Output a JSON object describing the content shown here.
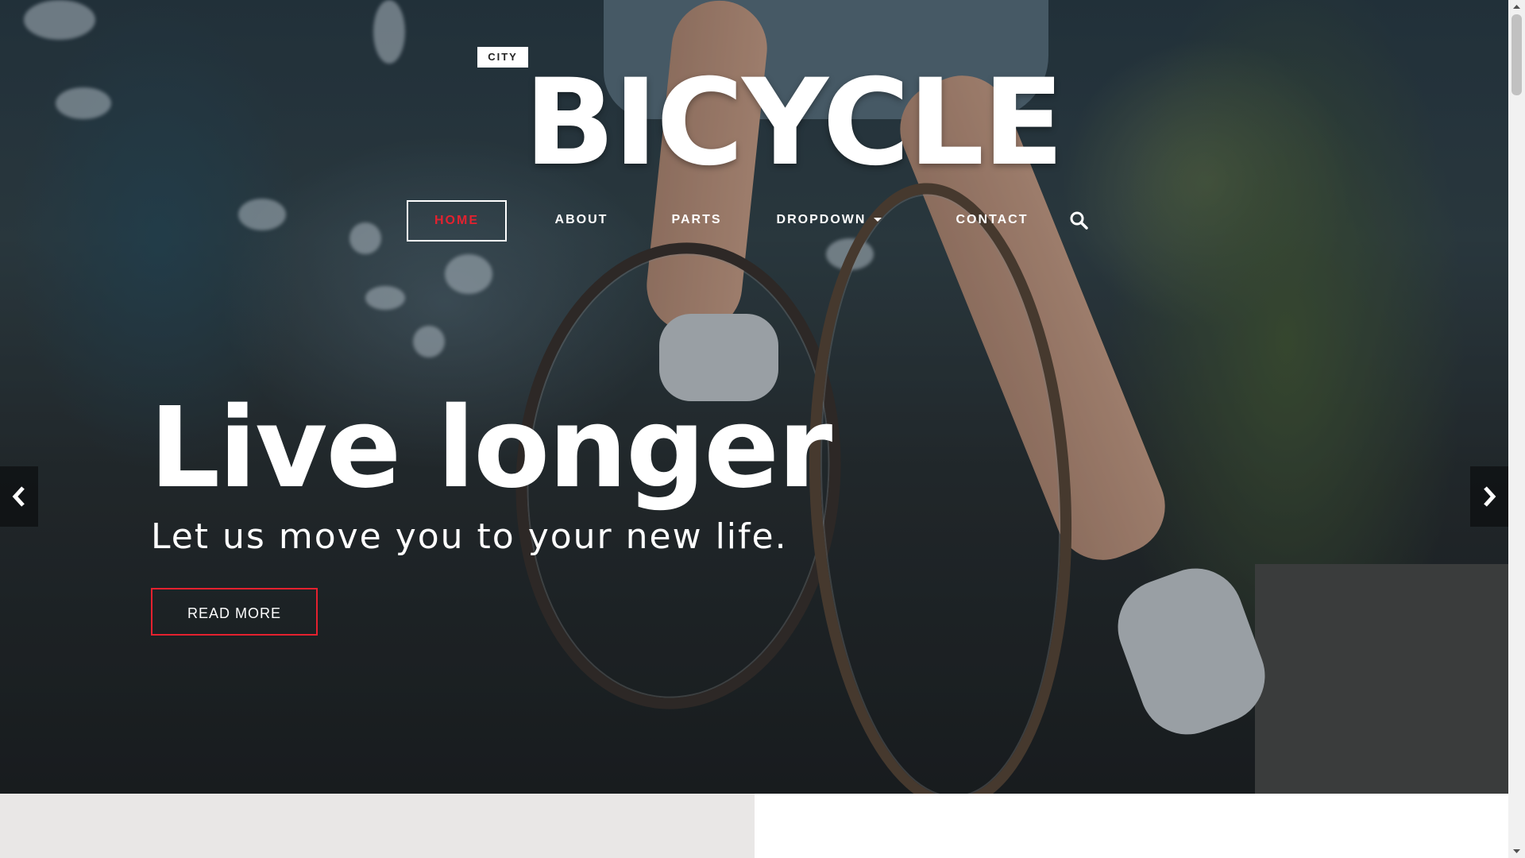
{
  "brand": {
    "tag": "CITY",
    "title": "BICYCLE"
  },
  "nav": {
    "items": [
      {
        "label": "HOME",
        "active": true
      },
      {
        "label": "ABOUT",
        "active": false
      },
      {
        "label": "PARTS",
        "active": false
      },
      {
        "label": "DROPDOWN",
        "active": false
      },
      {
        "label": "CONTACT",
        "active": false
      }
    ],
    "search_icon": "search-icon"
  },
  "hero": {
    "title": "Live longer",
    "subtitle": "Let us move you to your new life.",
    "button_label": "READ MORE"
  },
  "carousel": {
    "prev_icon": "chevron-left-icon",
    "next_icon": "chevron-right-icon"
  },
  "colors": {
    "accent": "#e4212f",
    "text": "#ffffff"
  }
}
